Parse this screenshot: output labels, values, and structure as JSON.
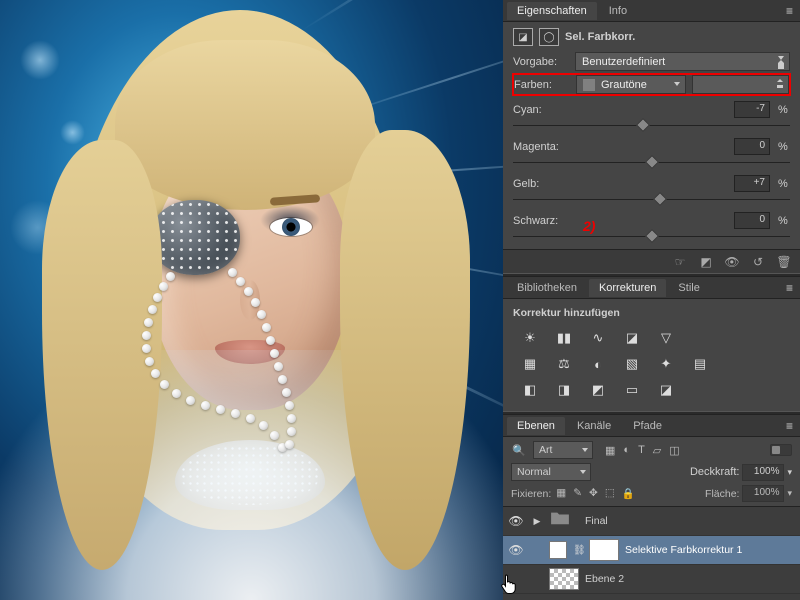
{
  "props": {
    "tabs": {
      "properties": "Eigenschaften",
      "info": "Info"
    },
    "adj_name": "Sel. Farbkorr.",
    "preset_label": "Vorgabe:",
    "preset_value": "Benutzerdefiniert",
    "colors_label": "Farben:",
    "colors_value": "Grautöne",
    "annotation": "2)",
    "sliders": {
      "cyan": {
        "label": "Cyan:",
        "value": "-7",
        "pos": 47
      },
      "magenta": {
        "label": "Magenta:",
        "value": "0",
        "pos": 50
      },
      "yellow": {
        "label": "Gelb:",
        "value": "+7",
        "pos": 53
      },
      "black": {
        "label": "Schwarz:",
        "value": "0",
        "pos": 50
      }
    },
    "pct": "%"
  },
  "korr": {
    "tabs": {
      "lib": "Bibliotheken",
      "adj": "Korrekturen",
      "styles": "Stile"
    },
    "heading": "Korrektur hinzufügen"
  },
  "layers": {
    "tabs": {
      "layers": "Ebenen",
      "channels": "Kanäle",
      "paths": "Pfade"
    },
    "kind": "Art",
    "blend_mode": "Normal",
    "opacity_label": "Deckkraft:",
    "opacity_value": "100%",
    "lock_label": "Fixieren:",
    "fill_label": "Fläche:",
    "fill_value": "100%",
    "items": {
      "group": "Final",
      "sel": "Selektive Farbkorrektur 1",
      "l2": "Ebene 2"
    }
  }
}
